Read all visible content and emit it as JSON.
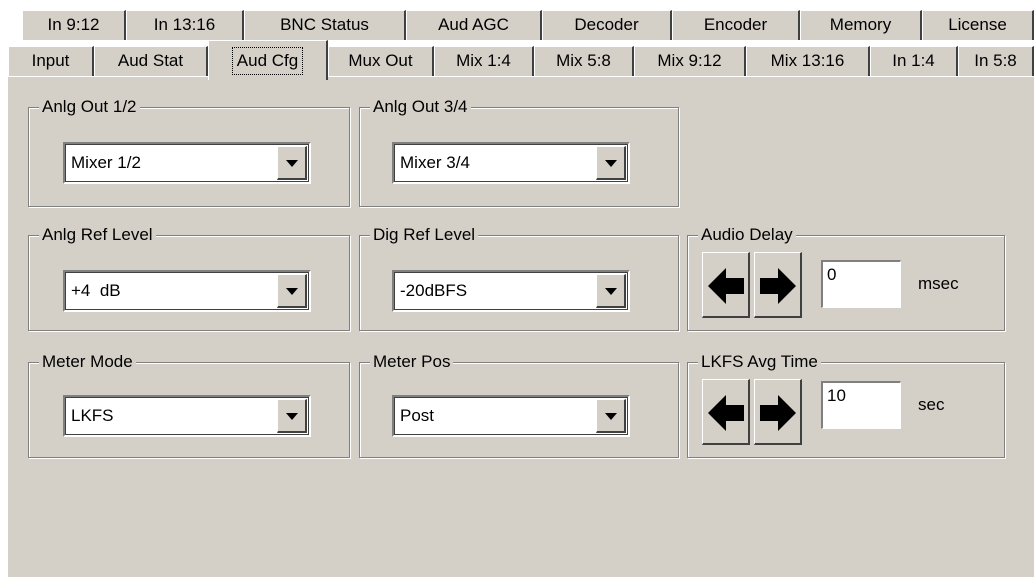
{
  "tabs_back_row": [
    "In 9:12",
    "In 13:16",
    "BNC Status",
    "Aud AGC",
    "Decoder",
    "Encoder",
    "Memory",
    "License"
  ],
  "tabs_front_row": [
    "Input",
    "Aud Stat",
    "Aud Cfg",
    "Mux Out",
    "Mix 1:4",
    "Mix 5:8",
    "Mix 9:12",
    "Mix 13:16",
    "In 1:4",
    "In 5:8"
  ],
  "active_tab": "Aud Cfg",
  "groups": {
    "anlg_out_12": {
      "title": "Anlg Out 1/2",
      "value": "Mixer 1/2"
    },
    "anlg_out_34": {
      "title": "Anlg Out 3/4",
      "value": "Mixer 3/4"
    },
    "anlg_ref_level": {
      "title": "Anlg Ref Level",
      "value": "+4  dB"
    },
    "dig_ref_level": {
      "title": "Dig Ref Level",
      "value": "-20dBFS"
    },
    "meter_mode": {
      "title": "Meter Mode",
      "value": "LKFS"
    },
    "meter_pos": {
      "title": "Meter Pos",
      "value": "Post"
    },
    "audio_delay": {
      "title": "Audio Delay",
      "value": "0",
      "unit": "msec"
    },
    "lkfs_avg_time": {
      "title": "LKFS Avg Time",
      "value": "10",
      "unit": "sec"
    }
  },
  "icons": {
    "decrease": "left-arrow-icon",
    "increase": "right-arrow-icon",
    "dropdown": "dropdown-triangle-icon"
  },
  "colors": {
    "face": "#d4d0c8",
    "field": "#ffffff",
    "shadow": "#808080",
    "highlight": "#ffffff"
  }
}
